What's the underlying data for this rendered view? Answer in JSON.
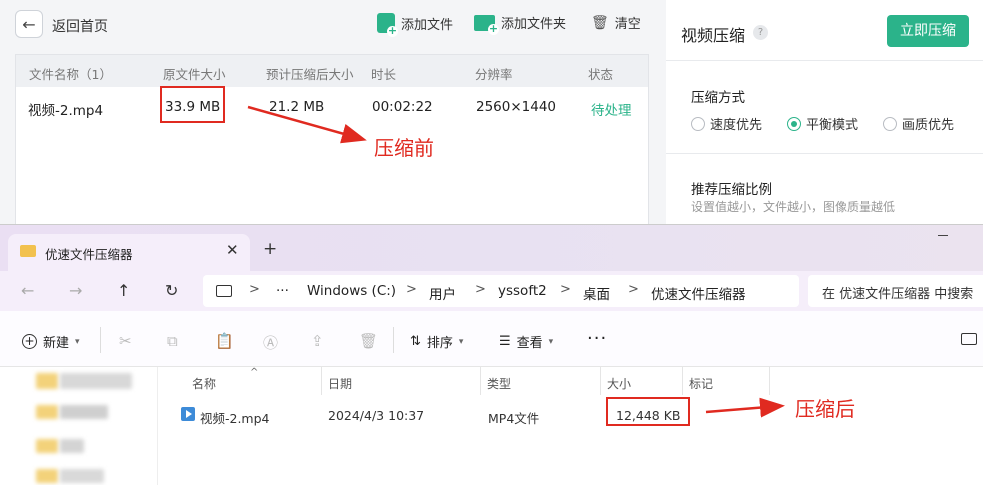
{
  "app": {
    "back_label": "返回首页",
    "toolbar": {
      "add_file": "添加文件",
      "add_folder": "添加文件夹",
      "clear": "清空"
    },
    "columns": [
      "文件名称（1）",
      "原文件大小",
      "预计压缩后大小",
      "时长",
      "分辨率",
      "状态"
    ],
    "row": {
      "name": "视频-2.mp4",
      "orig_size": "33.9 MB",
      "est_size": "21.2 MB",
      "duration": "00:02:22",
      "resolution": "2560×1440",
      "status": "待处理"
    },
    "panel": {
      "title": "视频压缩",
      "help": "?",
      "compress_button": "立即压缩",
      "mode_title": "压缩方式",
      "modes": [
        "速度优先",
        "平衡模式",
        "画质优先"
      ],
      "selected_mode": "平衡模式",
      "ratio_title": "推荐压缩比例",
      "ratio_hint": "设置值越小，文件越小，图像质量越低"
    },
    "accent_color": "#2bb38a"
  },
  "annotations": {
    "before": "压缩前",
    "after": "压缩后",
    "color": "#e02a20"
  },
  "explorer": {
    "tab_title": "优速文件压缩器",
    "tab_close": "✕",
    "tab_add": "+",
    "breadcrumbs": [
      "Windows (C:)",
      "用户",
      "yssoft2",
      "桌面",
      "优速文件压缩器"
    ],
    "ellipsis": "···",
    "search_placeholder": "在 优速文件压缩器 中搜索",
    "cmd": {
      "new": "新建",
      "sort": "排序",
      "view": "查看",
      "more": "···"
    },
    "columns": [
      "名称",
      "日期",
      "类型",
      "大小",
      "标记"
    ],
    "file": {
      "name": "视频-2.mp4",
      "date": "2024/4/3 10:37",
      "type": "MP4文件",
      "size": "12,448 KB"
    }
  }
}
